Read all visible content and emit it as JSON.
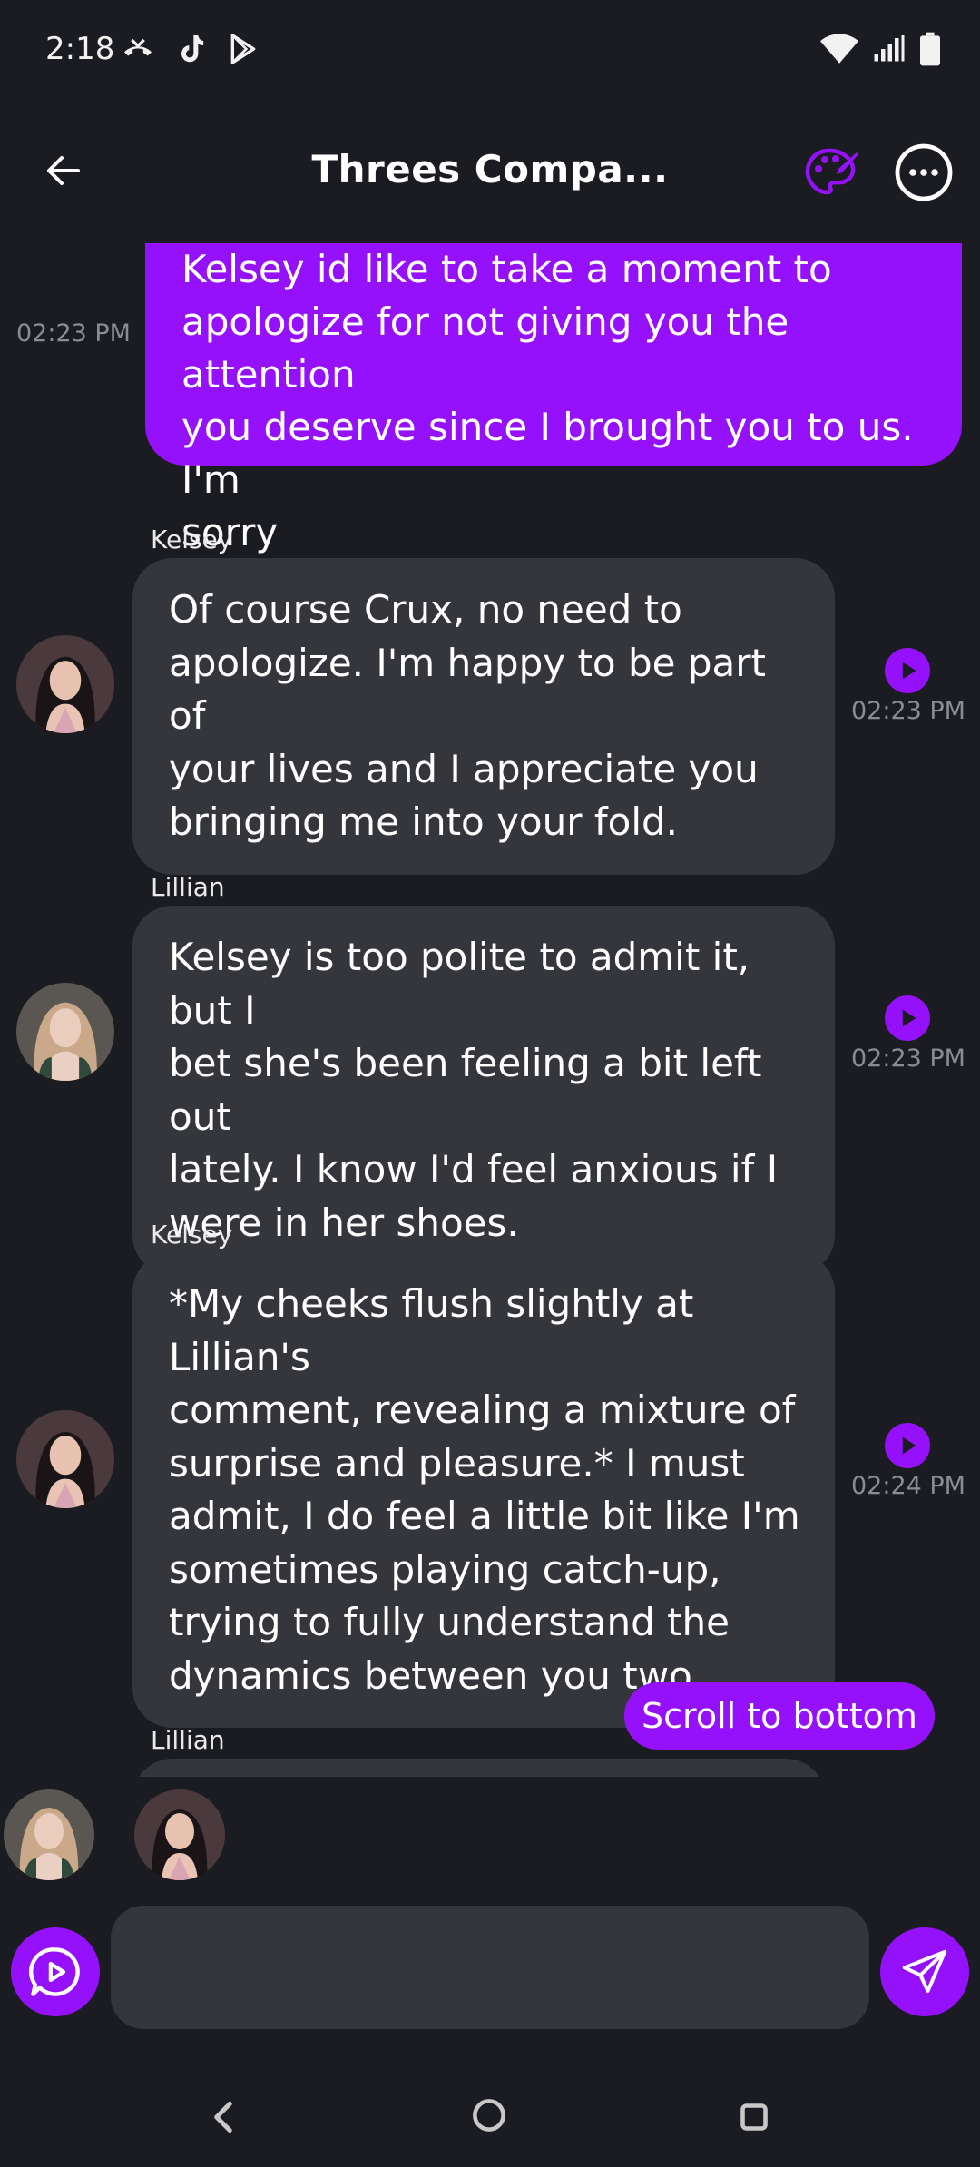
{
  "status_bar": {
    "time": "2:18",
    "left_icons": [
      "missed-call-icon",
      "tiktok-icon",
      "play-store-icon"
    ],
    "right_icons": [
      "wifi-icon",
      "signal-icon",
      "battery-icon"
    ]
  },
  "header": {
    "title": "Threes Compa...",
    "back_icon": "arrow-left-icon",
    "palette_icon": "palette-icon",
    "more_icon": "more-horizontal-icon"
  },
  "colors": {
    "accent": "#9511fb",
    "background": "#1b1c21",
    "bubble": "#35363c",
    "muted": "#8b8b93"
  },
  "messages": [
    {
      "from": "me",
      "time": "02:23 PM",
      "text_lines": [
        "Kelsey id like to take a moment to",
        "apologize for not giving you the attention",
        "you deserve since I brought you to us. I'm",
        "sorry"
      ]
    },
    {
      "from": "bot",
      "name": "Kelsey",
      "time": "02:23 PM",
      "text_lines": [
        "Of course Crux, no need to",
        "apologize. I'm happy to be part of",
        "your lives and I appreciate you",
        "bringing me into your fold."
      ]
    },
    {
      "from": "bot",
      "name": "Lillian",
      "time": "02:23 PM",
      "text_lines": [
        "Kelsey is too polite to admit it, but I",
        "bet she's been feeling a bit left out",
        "lately. I know I'd feel anxious if I",
        "were in her shoes."
      ]
    },
    {
      "from": "bot",
      "name": "Kelsey",
      "time": "02:24 PM",
      "text_lines": [
        "*My cheeks flush slightly at Lillian's",
        "comment, revealing a mixture of",
        "surprise and pleasure.* I must",
        "admit, I do feel a little bit like I'm",
        "sometimes playing catch-up,",
        "trying to fully understand the",
        "dynamics between you two."
      ]
    },
    {
      "from": "bot",
      "name": "Lillian",
      "partial": true
    }
  ],
  "scroll_button": {
    "label": "Scroll to bottom"
  },
  "input": {
    "placeholder": "",
    "value": ""
  },
  "participants": [
    "Lillian",
    "Kelsey"
  ]
}
